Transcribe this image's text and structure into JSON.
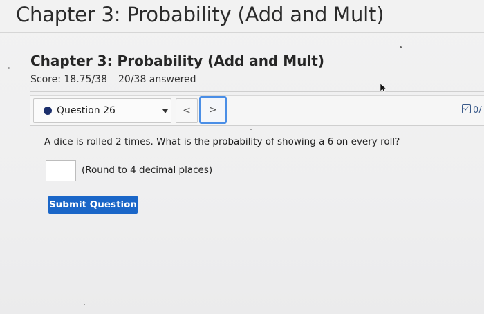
{
  "page": {
    "header_title": "Chapter 3: Probability (Add and Mult)"
  },
  "assignment": {
    "title": "Chapter 3: Probability (Add and Mult)",
    "score": "Score: 18.75/38",
    "answered": "20/38 answered"
  },
  "navigation": {
    "question_label": "Question 26",
    "prev_symbol": "<",
    "next_symbol": ">"
  },
  "side_tool": {
    "label": "0/"
  },
  "question": {
    "prompt": "A dice is rolled 2 times. What is the probability of showing a 6 on every roll?",
    "answer_value": "",
    "hint": "(Round to 4 decimal places)"
  },
  "actions": {
    "submit_label": "Submit Question"
  },
  "colors": {
    "accent_blue": "#1a66c8",
    "focus_outline": "#4a8ee6",
    "question_dot": "#1b2e6b"
  },
  "icons": {
    "question_status": "filled-circle-icon",
    "dropdown": "caret-down-icon",
    "prev": "chevron-left-icon",
    "next": "chevron-right-icon",
    "side_tool": "checkbox-icon",
    "cursor": "mouse-pointer-icon"
  }
}
